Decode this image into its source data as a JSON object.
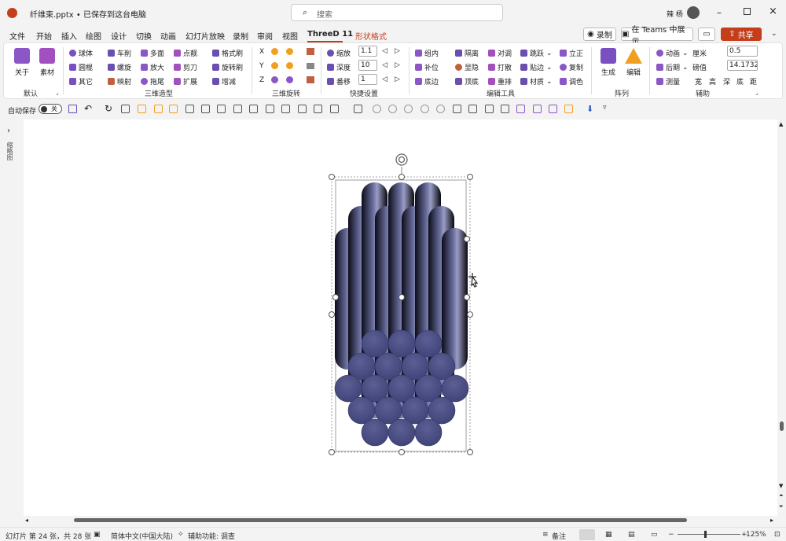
{
  "app": {
    "file_title": "纤维束.pptx • 已保存到这台电脑",
    "search_placeholder": "搜索",
    "user": "辣 杨"
  },
  "tabs": [
    {
      "label": "文件"
    },
    {
      "label": "开始"
    },
    {
      "label": "插入"
    },
    {
      "label": "绘图"
    },
    {
      "label": "设计"
    },
    {
      "label": "切换"
    },
    {
      "label": "动画"
    },
    {
      "label": "幻灯片放映"
    },
    {
      "label": "录制"
    },
    {
      "label": "审阅"
    },
    {
      "label": "视图"
    },
    {
      "label": "ThreeD 11"
    },
    {
      "label": "形状格式"
    }
  ],
  "actions": {
    "record": "录制",
    "teams": "在 Teams 中展示",
    "share": "共享"
  },
  "ribbon": {
    "default": {
      "about": "关于",
      "assets": "素材",
      "group": "默认"
    },
    "modeling": {
      "items": [
        "球体",
        "圆棍",
        "其它",
        "车削",
        "螺旋",
        "映射",
        "多面",
        "放大",
        "拖尾",
        "点靓",
        "剪刀",
        "扩展",
        "格式刷",
        "旋转刷",
        "增减"
      ],
      "group": "三维造型"
    },
    "rotation": {
      "axes": [
        "X",
        "Y",
        "Z"
      ],
      "group": "三维旋转"
    },
    "quick": {
      "zoom_label": "缩放",
      "zoom_value": "1.1",
      "depth_label": "深度",
      "depth_value": "10",
      "shift_label": "番移",
      "shift_value": "1",
      "group": "快捷设置"
    },
    "edit": {
      "items": [
        "组内",
        "补位",
        "底边",
        "隔离",
        "显隐",
        "顶底",
        "对调",
        "打散",
        "重排",
        "跳跃",
        "贴边",
        "材质",
        "立正",
        "复制",
        "调色"
      ],
      "group": "编辑工具"
    },
    "array": {
      "generate": "生成",
      "edit": "编辑",
      "group": "阵列"
    },
    "aux": {
      "anim": "动画",
      "later": "后期",
      "measure": "测量",
      "cm_label": "厘米",
      "cm_value": "0.5",
      "pound_label": "磅值",
      "pound_value": "14.17323",
      "dims": [
        "宽",
        "高",
        "深",
        "底",
        "距"
      ],
      "group": "辅助"
    }
  },
  "qat": {
    "autosave": "自动保存",
    "toggle": "关"
  },
  "sidepanel": {
    "label": "缩略图"
  },
  "status": {
    "slide": "幻灯片 第 24 张，共 28 张",
    "lang": "简体中文(中国大陆)",
    "access": "辅助功能: 调查",
    "notes": "备注",
    "zoom": "125%"
  },
  "colors": {
    "accent": "#c43e1c",
    "fiber": "#4b4e82"
  }
}
